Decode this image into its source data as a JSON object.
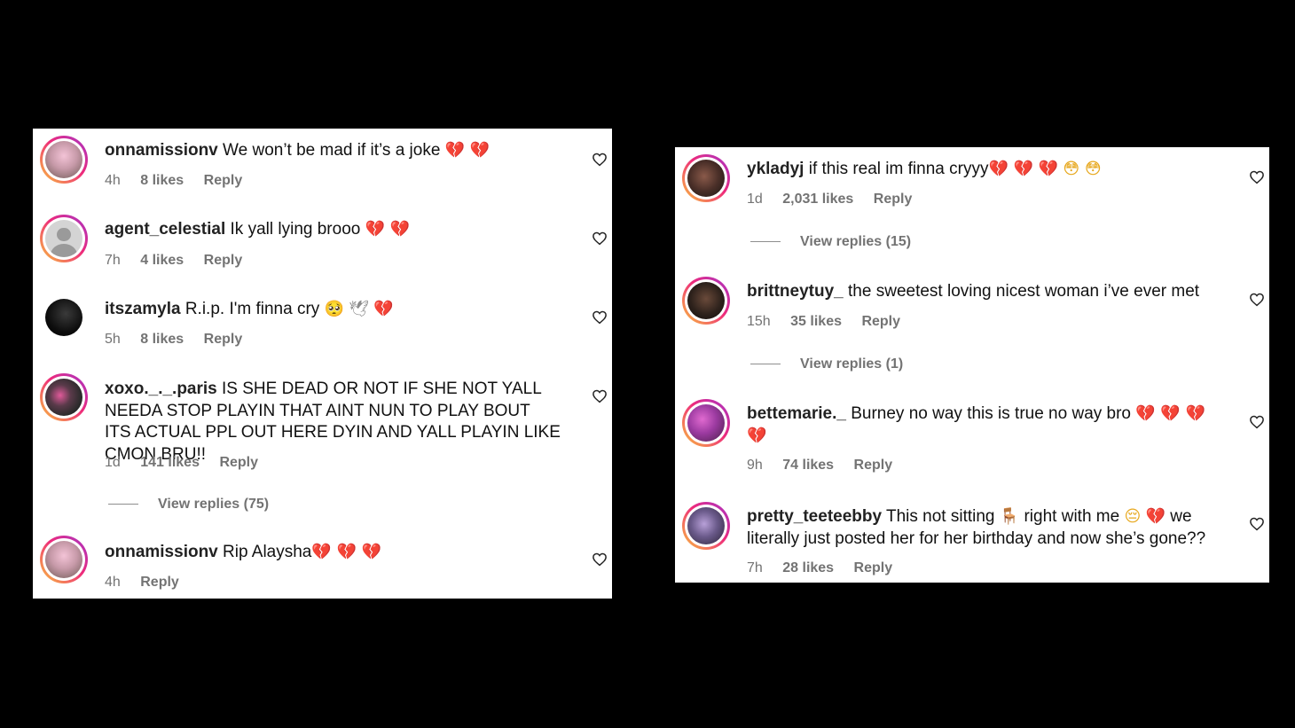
{
  "left": {
    "comments": [
      {
        "username": "onnamissionv",
        "text": "We won’t be mad if it’s a joke",
        "emoji": "💔 💔",
        "time": "4h",
        "likes": "8 likes",
        "reply": "Reply",
        "avatar": "avatar-photo"
      },
      {
        "username": "agent_celestial",
        "text": "Ik yall lying brooo",
        "emoji": "💔 💔",
        "time": "7h",
        "likes": "4 likes",
        "reply": "Reply",
        "avatar": "default-avatar"
      },
      {
        "username": "itszamyla",
        "text": "R.i.p. I'm finna cry",
        "emoji_sad": "🥺",
        "emoji_dove": "🕊",
        "emoji": "💔",
        "time": "5h",
        "likes": "8 likes",
        "reply": "Reply",
        "avatar": "dark-avatar"
      },
      {
        "username": "xoxo._._.paris",
        "text": "IS SHE DEAD OR NOT IF SHE NOT YALL NEEDA STOP PLAYIN THAT AINT NUN TO PLAY BOUT ITS ACTUAL PPL OUT HERE DYIN AND YALL PLAYIN LIKE CMON BRU!!",
        "time": "1d",
        "likes": "141 likes",
        "reply": "Reply",
        "view_replies": "View replies (75)",
        "avatar": "avatar-photo"
      },
      {
        "username": "onnamissionv",
        "text": "Rip Alaysha",
        "emoji": "💔 💔 💔",
        "time": "4h",
        "reply": "Reply",
        "avatar": "avatar-photo"
      }
    ]
  },
  "right": {
    "comments": [
      {
        "username": "ykladyj",
        "text": "if this real im finna cryyy",
        "emoji": "💔 💔 💔",
        "emoji_flushed": "😳 😳",
        "time": "1d",
        "likes": "2,031 likes",
        "reply": "Reply",
        "view_replies": "View replies (15)",
        "avatar": "avatar-photo"
      },
      {
        "username": "brittneytuy_",
        "text": "the sweetest loving nicest woman i’ve ever met",
        "time": "15h",
        "likes": "35 likes",
        "reply": "Reply",
        "view_replies": "View replies (1)",
        "avatar": "avatar-photo"
      },
      {
        "username": "bettemarie._",
        "text": "Burney no way this is true no way bro",
        "emoji": "💔 💔 💔",
        "emoji_line2": "💔",
        "time": "9h",
        "likes": "74 likes",
        "reply": "Reply",
        "avatar": "avatar-photo"
      },
      {
        "username": "pretty_teeteebby",
        "text_a": "This not sitting",
        "emoji_chair": "🪑",
        "text_b": "right with me",
        "emoji_pensive": "😔",
        "emoji": "💔",
        "text_c": "we literally just posted her for her birthday and now she’s gone??",
        "time": "7h",
        "likes": "28 likes",
        "reply": "Reply",
        "avatar": "avatar-photo"
      }
    ]
  },
  "colors": {
    "background": "#000000",
    "panel": "#ffffff",
    "meta_text": "#737373",
    "heart_emoji": "#e0245e"
  }
}
